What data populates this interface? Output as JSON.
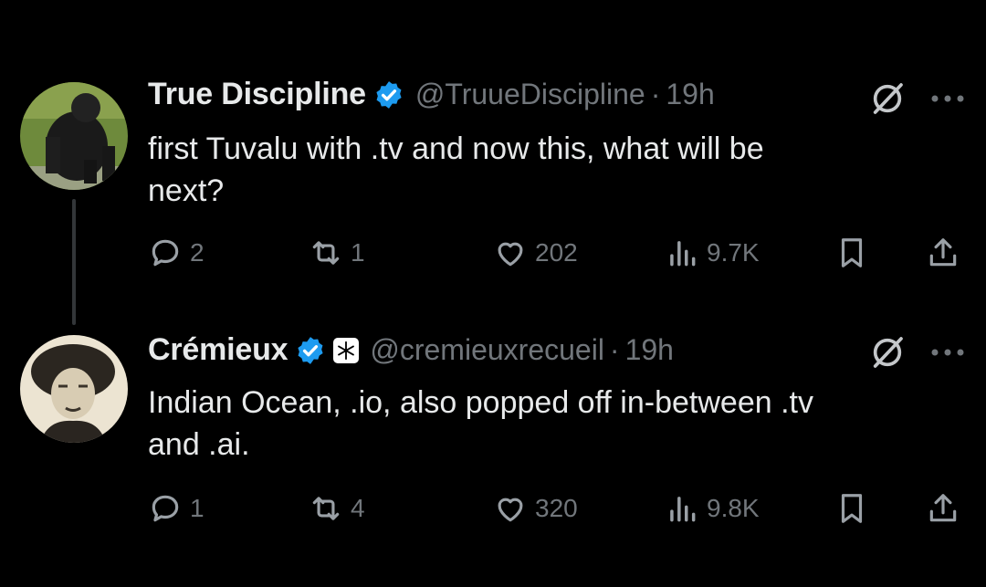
{
  "tweets": [
    {
      "name": "True Discipline",
      "handle": "@TruueDiscipline",
      "dot": "·",
      "time": "19h",
      "text_line1": "first Tuvalu with .tv and now this, what will be",
      "text_line2": "next?",
      "replies": "2",
      "reposts": "1",
      "likes": "202",
      "views": "9.7K",
      "avatar": "gorilla-avatar"
    },
    {
      "name": "Crémieux",
      "handle": "@cremieuxrecueil",
      "dot": "·",
      "time": "19h",
      "text_line1": "Indian Ocean, .io, also popped off in-between .tv",
      "text_line2": "and .ai.",
      "replies": "1",
      "reposts": "4",
      "likes": "320",
      "views": "9.8K",
      "avatar": "caricature-avatar"
    }
  ],
  "colors": {
    "background": "#000000",
    "text": "#e7e9ea",
    "muted": "#71767b",
    "verified": "#1d9bf0",
    "thread_line": "#333639"
  },
  "icons": [
    "reply-icon",
    "repost-icon",
    "like-icon",
    "views-icon",
    "bookmark-icon",
    "share-icon",
    "grok-icon",
    "more-icon",
    "verified-badge-icon"
  ]
}
